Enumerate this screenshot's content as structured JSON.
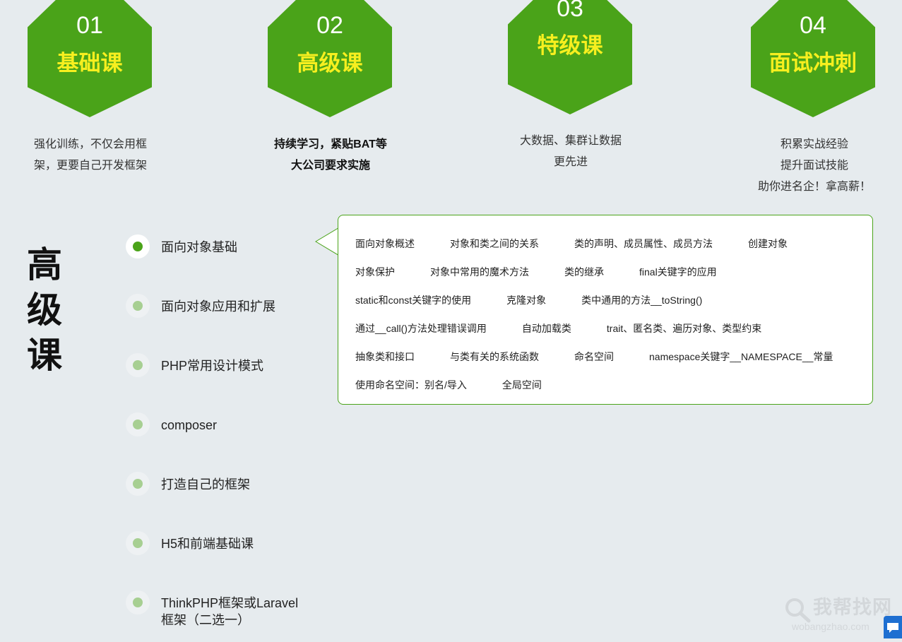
{
  "courses": [
    {
      "num": "01",
      "title": "基础课",
      "desc": [
        "强化训练，不仅会用框",
        "架，更要自己开发框架"
      ],
      "bold": false
    },
    {
      "num": "02",
      "title": "高级课",
      "desc": [
        "持续学习，紧贴BAT等",
        "大公司要求实施"
      ],
      "bold": true
    },
    {
      "num": "03",
      "title": "特级课",
      "desc": [
        "大数据、集群让数据",
        "更先进"
      ],
      "bold": false
    },
    {
      "num": "04",
      "title": "面试冲刺",
      "desc": [
        "积累实战经验",
        "提升面试技能",
        "助你进名企！拿高薪！"
      ],
      "bold": false
    }
  ],
  "section_title": [
    "高",
    "级",
    "课"
  ],
  "topics": [
    {
      "label": "面向对象基础",
      "active": true
    },
    {
      "label": "面向对象应用和扩展",
      "active": false
    },
    {
      "label": "PHP常用设计模式",
      "active": false
    },
    {
      "label": "composer",
      "active": false
    },
    {
      "label": "打造自己的框架",
      "active": false
    },
    {
      "label": "H5和前端基础课",
      "active": false
    },
    {
      "label": "ThinkPHP框架或Laravel\n框架（二选一）",
      "active": false
    }
  ],
  "detail_rows": [
    [
      "面向对象概述",
      "对象和类之间的关系",
      "类的声明、成员属性、成员方法",
      "创建对象"
    ],
    [
      "对象保护",
      "对象中常用的魔术方法",
      "类的继承",
      "final关键字的应用"
    ],
    [
      "static和const关键字的使用",
      "克隆对象",
      "类中通用的方法__toString()"
    ],
    [
      "通过__call()方法处理错误调用",
      "自动加载类",
      "trait、匿名类、遍历对象、类型约束"
    ],
    [
      "抽象类和接口",
      "与类有关的系统函数",
      "命名空间",
      "namespace关键字__NAMESPACE__常量"
    ],
    [
      "使用命名空间：别名/导入",
      "全局空间"
    ]
  ],
  "watermark": {
    "main": "我帮找网",
    "sub": "wobangzhao.com"
  },
  "colors": {
    "accent": "#4aa319",
    "hex_title": "#f7ef1f",
    "background": "#e6ebee",
    "dot_inactive": "#a7cf92"
  },
  "icons": {
    "watermark": "magnifier-icon",
    "chat": "chat-icon"
  }
}
